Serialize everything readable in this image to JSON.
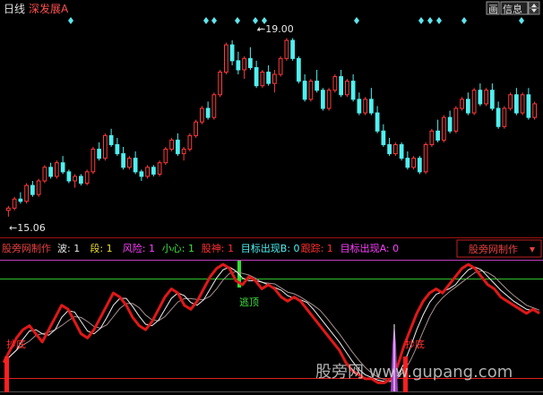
{
  "header": {
    "period": "日线",
    "stock_name": "深发展A",
    "btn_draw": "画",
    "btn_info": "信息",
    "colors": {
      "period": "#e0e0e0",
      "stock": "#ff5050"
    }
  },
  "upper_chart": {
    "high_label": "19.00",
    "low_label": "15.06",
    "colors": {
      "up": "#ff3b3b",
      "down": "#4ff0f0",
      "marker": "#5fe6ee"
    }
  },
  "indicator_bar": {
    "name": "股旁网制作",
    "params": [
      {
        "label": "波: 1",
        "color": "#e6e6e6"
      },
      {
        "label": "段: 1",
        "color": "#f0e030"
      },
      {
        "label": "风险: 1",
        "color": "#ff40ff"
      },
      {
        "label": "小心: 1",
        "color": "#40e040"
      },
      {
        "label": "股神: 1",
        "color": "#ff3030"
      },
      {
        "label": "目标出现B: 0",
        "color": "#4ff0f0"
      },
      {
        "label": "跟踪: 1",
        "color": "#ff3030"
      },
      {
        "label": "目标出现A: 0",
        "color": "#ff40ff"
      }
    ],
    "dropdown_label": "股旁网制作"
  },
  "lower_chart": {
    "escape_label": "逃顶",
    "bottom_labels": [
      "抄底",
      "抄底"
    ],
    "watermark": "股旁网 www.gupang.com",
    "colors": {
      "main": "#e81818",
      "thin1": "#ffffff",
      "thin2": "#c0a0a0",
      "top_line": "#30d030",
      "upper_line": "#d030d0",
      "bottom_line": "#e02020"
    }
  },
  "chart_data": {
    "type": "candlestick",
    "title": "深发展A 日线",
    "price_labels": {
      "high": 19.0,
      "low": 15.06
    },
    "candles": [
      [
        15.2,
        15.3,
        15.06,
        15.25
      ],
      [
        15.25,
        15.5,
        15.2,
        15.45
      ],
      [
        15.45,
        15.6,
        15.35,
        15.4
      ],
      [
        15.4,
        15.8,
        15.35,
        15.75
      ],
      [
        15.75,
        15.85,
        15.5,
        15.55
      ],
      [
        15.55,
        15.9,
        15.5,
        15.85
      ],
      [
        15.85,
        16.2,
        15.8,
        16.15
      ],
      [
        16.15,
        16.25,
        15.9,
        15.95
      ],
      [
        15.95,
        16.3,
        15.9,
        16.25
      ],
      [
        16.25,
        16.4,
        16.0,
        16.05
      ],
      [
        16.05,
        16.1,
        15.8,
        15.85
      ],
      [
        15.85,
        16.0,
        15.7,
        15.95
      ],
      [
        15.95,
        16.0,
        15.75,
        15.8
      ],
      [
        15.8,
        16.1,
        15.75,
        16.05
      ],
      [
        16.05,
        16.6,
        16.0,
        16.55
      ],
      [
        16.55,
        16.7,
        16.3,
        16.35
      ],
      [
        16.35,
        16.9,
        16.3,
        16.85
      ],
      [
        16.85,
        17.0,
        16.6,
        16.65
      ],
      [
        16.65,
        16.8,
        16.4,
        16.45
      ],
      [
        16.45,
        16.6,
        16.1,
        16.15
      ],
      [
        16.15,
        16.4,
        16.1,
        16.35
      ],
      [
        16.35,
        16.5,
        16.0,
        16.05
      ],
      [
        16.05,
        16.1,
        15.85,
        15.95
      ],
      [
        15.95,
        16.2,
        15.9,
        16.15
      ],
      [
        16.15,
        16.2,
        15.95,
        16.0
      ],
      [
        16.0,
        16.3,
        15.95,
        16.25
      ],
      [
        16.25,
        16.6,
        16.2,
        16.55
      ],
      [
        16.55,
        16.8,
        16.5,
        16.75
      ],
      [
        16.75,
        16.9,
        16.4,
        16.45
      ],
      [
        16.45,
        16.6,
        16.3,
        16.55
      ],
      [
        16.55,
        16.9,
        16.5,
        16.85
      ],
      [
        16.85,
        17.2,
        16.8,
        17.15
      ],
      [
        17.15,
        17.5,
        17.1,
        17.45
      ],
      [
        17.45,
        17.6,
        17.2,
        17.25
      ],
      [
        17.25,
        17.8,
        17.2,
        17.75
      ],
      [
        17.75,
        18.3,
        17.7,
        18.25
      ],
      [
        18.25,
        18.9,
        18.2,
        18.85
      ],
      [
        18.85,
        18.95,
        18.4,
        18.5
      ],
      [
        18.5,
        18.7,
        18.2,
        18.3
      ],
      [
        18.3,
        18.6,
        18.1,
        18.55
      ],
      [
        18.55,
        18.8,
        18.3,
        18.35
      ],
      [
        18.35,
        18.5,
        17.9,
        17.95
      ],
      [
        17.95,
        18.3,
        17.9,
        18.25
      ],
      [
        18.25,
        18.4,
        17.95,
        18.0
      ],
      [
        18.0,
        18.3,
        17.8,
        18.2
      ],
      [
        18.2,
        18.6,
        18.15,
        18.55
      ],
      [
        18.55,
        19.0,
        18.5,
        18.95
      ],
      [
        18.95,
        19.0,
        18.5,
        18.55
      ],
      [
        18.55,
        18.6,
        18.0,
        18.05
      ],
      [
        18.05,
        18.2,
        17.6,
        17.65
      ],
      [
        17.65,
        18.1,
        17.6,
        18.05
      ],
      [
        18.05,
        18.3,
        17.8,
        17.85
      ],
      [
        17.85,
        17.9,
        17.4,
        17.45
      ],
      [
        17.45,
        17.9,
        17.4,
        17.85
      ],
      [
        17.85,
        18.2,
        17.8,
        18.15
      ],
      [
        18.15,
        18.3,
        17.7,
        17.75
      ],
      [
        17.75,
        18.1,
        17.7,
        18.05
      ],
      [
        18.05,
        18.2,
        17.6,
        17.65
      ],
      [
        17.65,
        17.8,
        17.3,
        17.35
      ],
      [
        17.35,
        17.7,
        17.3,
        17.65
      ],
      [
        17.65,
        17.9,
        17.3,
        17.35
      ],
      [
        17.35,
        17.5,
        16.9,
        16.95
      ],
      [
        16.95,
        17.1,
        16.6,
        16.65
      ],
      [
        16.65,
        16.8,
        16.4,
        16.45
      ],
      [
        16.45,
        16.7,
        16.4,
        16.65
      ],
      [
        16.65,
        16.7,
        16.3,
        16.35
      ],
      [
        16.35,
        16.5,
        16.1,
        16.15
      ],
      [
        16.15,
        16.4,
        16.1,
        16.35
      ],
      [
        16.35,
        16.4,
        16.0,
        16.05
      ],
      [
        16.05,
        16.7,
        16.0,
        16.65
      ],
      [
        16.65,
        17.0,
        16.6,
        16.95
      ],
      [
        16.95,
        17.2,
        16.7,
        16.75
      ],
      [
        16.75,
        17.3,
        16.7,
        17.25
      ],
      [
        17.25,
        17.4,
        16.9,
        16.95
      ],
      [
        16.95,
        17.5,
        16.9,
        17.45
      ],
      [
        17.45,
        17.7,
        17.4,
        17.65
      ],
      [
        17.65,
        17.8,
        17.3,
        17.35
      ],
      [
        17.35,
        17.9,
        17.3,
        17.85
      ],
      [
        17.85,
        18.0,
        17.5,
        17.55
      ],
      [
        17.55,
        17.9,
        17.5,
        17.85
      ],
      [
        17.85,
        18.0,
        17.4,
        17.45
      ],
      [
        17.45,
        17.6,
        17.0,
        17.05
      ],
      [
        17.05,
        17.5,
        17.0,
        17.45
      ],
      [
        17.45,
        17.8,
        17.4,
        17.75
      ],
      [
        17.75,
        17.9,
        17.3,
        17.35
      ],
      [
        17.35,
        17.8,
        17.3,
        17.75
      ],
      [
        17.75,
        17.9,
        17.2,
        17.25
      ],
      [
        17.25,
        17.6,
        17.2,
        17.55
      ]
    ],
    "indicator": {
      "main": [
        6,
        9,
        12,
        14,
        15,
        13,
        11,
        14,
        17,
        20,
        19,
        16,
        13,
        12,
        14,
        17,
        20,
        23,
        22,
        20,
        17,
        15,
        14,
        16,
        19,
        22,
        24,
        23,
        20,
        19,
        21,
        24,
        27,
        29,
        30,
        29,
        26,
        25,
        27,
        26,
        24,
        25,
        24,
        22,
        21,
        22,
        21,
        19,
        17,
        15,
        13,
        11,
        9,
        6,
        4,
        3,
        2,
        2,
        1,
        1,
        2,
        5,
        10,
        14,
        18,
        21,
        23,
        24,
        23,
        25,
        27,
        29,
        30,
        29,
        27,
        25,
        24,
        22,
        21,
        20,
        19,
        18,
        19,
        18
      ]
    }
  }
}
